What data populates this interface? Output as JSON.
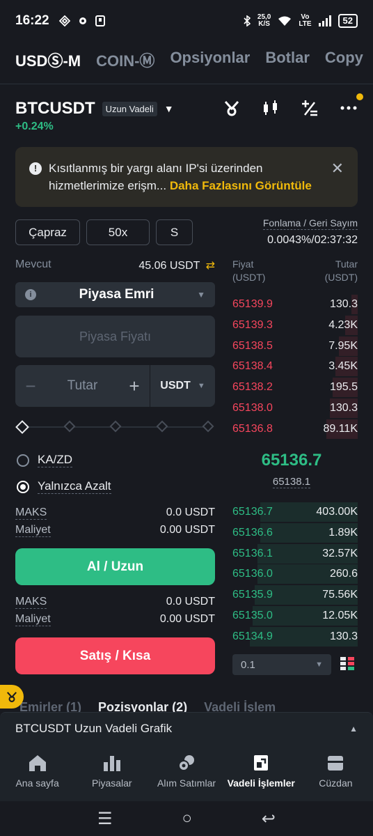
{
  "status": {
    "time": "16:22",
    "speed_top": "25,0",
    "speed_unit": "K/S",
    "net_top": "Vo",
    "net_bottom": "LTE",
    "battery": "52"
  },
  "top_tabs": [
    "USDⓈ-M",
    "COIN-Ⓜ",
    "Opsiyonlar",
    "Botlar",
    "Copy"
  ],
  "pair": {
    "symbol": "BTCUSDT",
    "badge": "Uzun Vadeli",
    "change": "+0.24%"
  },
  "warning": {
    "text": "Kısıtlanmış bir yargı alanı IP'si üzerinden hizmetlerimize erişm...",
    "link": "Daha Fazlasını Görüntüle"
  },
  "controls": {
    "margin_mode": "Çapraz",
    "leverage": "50x",
    "asset_mode": "S"
  },
  "funding": {
    "label": "Fonlama / Geri Sayım",
    "value": "0.0043%/02:37:32"
  },
  "available": {
    "label": "Mevcut",
    "value": "45.06 USDT"
  },
  "order_type": "Piyasa Emri",
  "price_placeholder": "Piyasa Fiyatı",
  "amount": {
    "placeholder": "Tutar",
    "unit": "USDT",
    "minus": "−",
    "plus": "+"
  },
  "slider_level": 0,
  "options": {
    "tpsl": "KA/ZD",
    "reduce_only": "Yalnızca Azalt",
    "reduce_only_checked": true
  },
  "buy": {
    "max_label": "MAKS",
    "max_value": "0.0 USDT",
    "cost_label": "Maliyet",
    "cost_value": "0.00 USDT",
    "button": "Al / Uzun"
  },
  "sell": {
    "max_label": "MAKS",
    "max_value": "0.0 USDT",
    "cost_label": "Maliyet",
    "cost_value": "0.00 USDT",
    "button": "Satış / Kısa"
  },
  "orderbook": {
    "price_header": "Fiyat\n(USDT)",
    "amount_header": "Tutar\n(USDT)",
    "asks": [
      {
        "price": "65139.9",
        "amount": "130.3",
        "depth": 0.05
      },
      {
        "price": "65139.3",
        "amount": "4.23K",
        "depth": 0.1
      },
      {
        "price": "65138.5",
        "amount": "7.95K",
        "depth": 0.15
      },
      {
        "price": "65138.4",
        "amount": "3.45K",
        "depth": 0.18
      },
      {
        "price": "65138.2",
        "amount": "195.5",
        "depth": 0.2
      },
      {
        "price": "65138.0",
        "amount": "130.3",
        "depth": 0.22
      },
      {
        "price": "65136.8",
        "amount": "89.11K",
        "depth": 0.25
      }
    ],
    "last_price": "65136.7",
    "mark_price": "65138.1",
    "bids": [
      {
        "price": "65136.7",
        "amount": "403.00K",
        "depth": 0.78
      },
      {
        "price": "65136.6",
        "amount": "1.89K",
        "depth": 0.78
      },
      {
        "price": "65136.1",
        "amount": "32.57K",
        "depth": 0.8
      },
      {
        "price": "65136.0",
        "amount": "260.6",
        "depth": 0.8
      },
      {
        "price": "65135.9",
        "amount": "75.56K",
        "depth": 0.82
      },
      {
        "price": "65135.0",
        "amount": "12.05K",
        "depth": 0.84
      },
      {
        "price": "65134.9",
        "amount": "130.3",
        "depth": 0.86
      }
    ],
    "depth_step": "0.1"
  },
  "bottom_tabs": [
    "Emirler (1)",
    "Pozisyonlar (2)",
    "Vadeli İşlem"
  ],
  "chart_bar": "BTCUSDT Uzun Vadeli Grafik",
  "nav": [
    "Ana sayfa",
    "Piyasalar",
    "Alım Satımlar",
    "Vadeli İşlemler",
    "Cüzdan"
  ],
  "colors": {
    "buy": "#2ebd85",
    "sell": "#f6465d",
    "accent": "#f0b90b",
    "bg": "#181a20"
  }
}
